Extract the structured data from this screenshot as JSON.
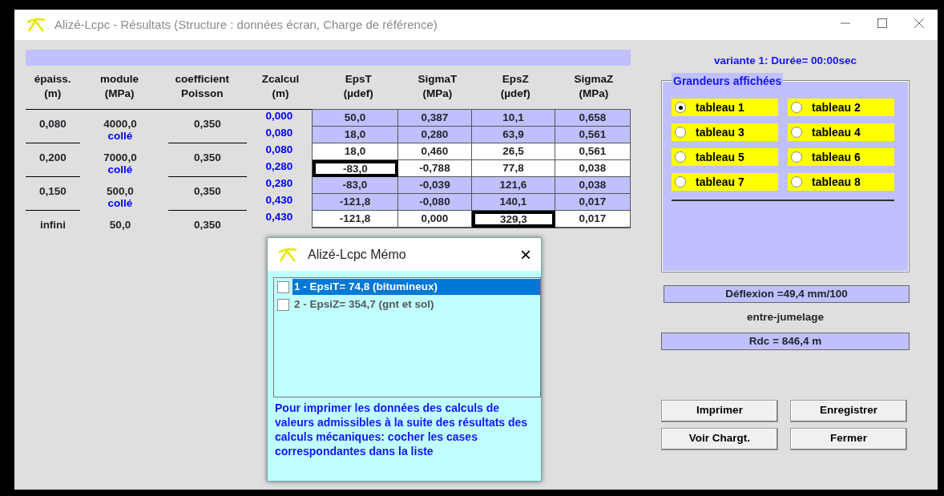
{
  "window": {
    "title": "Alizé-Lcpc - Résultats (Structure : données écran, Charge de référence)"
  },
  "table": {
    "columns": [
      {
        "line1": "épaiss.",
        "line2": "(m)"
      },
      {
        "line1": "module",
        "line2": "(MPa)"
      },
      {
        "line1": "coefficient",
        "line2": "Poisson"
      },
      {
        "line1": "Zcalcul",
        "line2": "(m)"
      },
      {
        "line1": "EpsT",
        "line2": "(µdef)"
      },
      {
        "line1": "SigmaT",
        "line2": "(MPa)"
      },
      {
        "line1": "EpsZ",
        "line2": "(µdef)"
      },
      {
        "line1": "SigmaZ",
        "line2": "(MPa)"
      }
    ],
    "layers": [
      {
        "thickness": "0,080",
        "modulus": "4000,0",
        "interface": "collé",
        "poisson": "0,350"
      },
      {
        "thickness": "0,200",
        "modulus": "7000,0",
        "interface": "collé",
        "poisson": "0,350"
      },
      {
        "thickness": "0,150",
        "modulus": "500,0",
        "interface": "collé",
        "poisson": "0,350"
      },
      {
        "thickness": "infini",
        "modulus": "50,0",
        "poisson": "0,350"
      }
    ],
    "rows": [
      {
        "zcalcul": "0,000",
        "shaded": true,
        "cells": [
          {
            "text": "50,0",
            "highlighted": false
          },
          {
            "text": "0,387",
            "highlighted": false
          },
          {
            "text": "10,1",
            "highlighted": false
          },
          {
            "text": "0,658",
            "highlighted": false
          }
        ]
      },
      {
        "zcalcul": "0,080",
        "shaded": true,
        "cells": [
          {
            "text": "18,0",
            "highlighted": false
          },
          {
            "text": "0,280",
            "highlighted": false
          },
          {
            "text": "63,9",
            "highlighted": false
          },
          {
            "text": "0,561",
            "highlighted": false
          }
        ]
      },
      {
        "zcalcul": "0,080",
        "shaded": false,
        "cells": [
          {
            "text": "18,0",
            "highlighted": false
          },
          {
            "text": "0,460",
            "highlighted": false
          },
          {
            "text": "26,5",
            "highlighted": false
          },
          {
            "text": "0,561",
            "highlighted": false
          }
        ]
      },
      {
        "zcalcul": "0,280",
        "shaded": false,
        "cells": [
          {
            "text": "-83,0",
            "highlighted": true
          },
          {
            "text": "-0,788",
            "highlighted": false
          },
          {
            "text": "77,8",
            "highlighted": false
          },
          {
            "text": "0,038",
            "highlighted": false
          }
        ]
      },
      {
        "zcalcul": "0,280",
        "shaded": true,
        "cells": [
          {
            "text": "-83,0",
            "highlighted": false
          },
          {
            "text": "-0,039",
            "highlighted": false
          },
          {
            "text": "121,6",
            "highlighted": false
          },
          {
            "text": "0,038",
            "highlighted": false
          }
        ]
      },
      {
        "zcalcul": "0,430",
        "shaded": true,
        "cells": [
          {
            "text": "-121,8",
            "highlighted": false
          },
          {
            "text": "-0,080",
            "highlighted": false
          },
          {
            "text": "140,1",
            "highlighted": false
          },
          {
            "text": "0,017",
            "highlighted": false
          }
        ]
      },
      {
        "zcalcul": "0,430",
        "shaded": false,
        "cells": [
          {
            "text": "-121,8",
            "highlighted": false
          },
          {
            "text": "0,000",
            "highlighted": false
          },
          {
            "text": "329,3",
            "highlighted": true
          },
          {
            "text": "0,017",
            "highlighted": false
          }
        ]
      }
    ]
  },
  "side": {
    "variant": "variante 1:  Durée= 00:00sec",
    "group_title": "Grandeurs affichées",
    "options": [
      {
        "label": "tableau 1",
        "selected": true
      },
      {
        "label": "tableau 2",
        "selected": false
      },
      {
        "label": "tableau 3",
        "selected": false
      },
      {
        "label": "tableau 4",
        "selected": false
      },
      {
        "label": "tableau 5",
        "selected": false
      },
      {
        "label": "tableau 6",
        "selected": false
      },
      {
        "label": "tableau 7",
        "selected": false
      },
      {
        "label": "tableau 8",
        "selected": false
      }
    ],
    "deflection": "Déflexion =49,4 mm/100",
    "deflection_note": "entre-jumelage",
    "rdc": "Rdc = 846,4 m",
    "buttons": [
      "Imprimer",
      "Enregistrer",
      "Voir Chargt.",
      "Fermer"
    ]
  },
  "memo": {
    "title": "Alizé-Lcpc Mémo",
    "close": "×",
    "items": [
      {
        "label": "1 - EpsiT= 74,8 (bitumineux)",
        "checked": false,
        "selected": true
      },
      {
        "label": "2 - EpsiZ= 354,7 (gnt et sol)",
        "checked": false,
        "selected": false
      }
    ],
    "note": "Pour imprimer les données des calculs de valeurs admissibles à la suite des résultats des calculs mécaniques: cocher les cases correspondantes dans la liste"
  }
}
